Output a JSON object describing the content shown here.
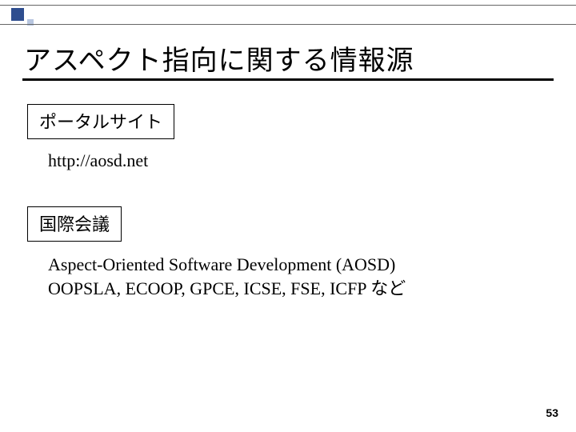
{
  "title": "アスペクト指向に関する情報源",
  "sections": {
    "portal": {
      "label": "ポータルサイト",
      "url": "http://aosd.net"
    },
    "conferences": {
      "label": "国際会議",
      "line1": "Aspect-Oriented Software Development (AOSD)",
      "line2": "OOPSLA, ECOOP, GPCE, ICSE, FSE, ICFP など"
    }
  },
  "page_number": "53"
}
